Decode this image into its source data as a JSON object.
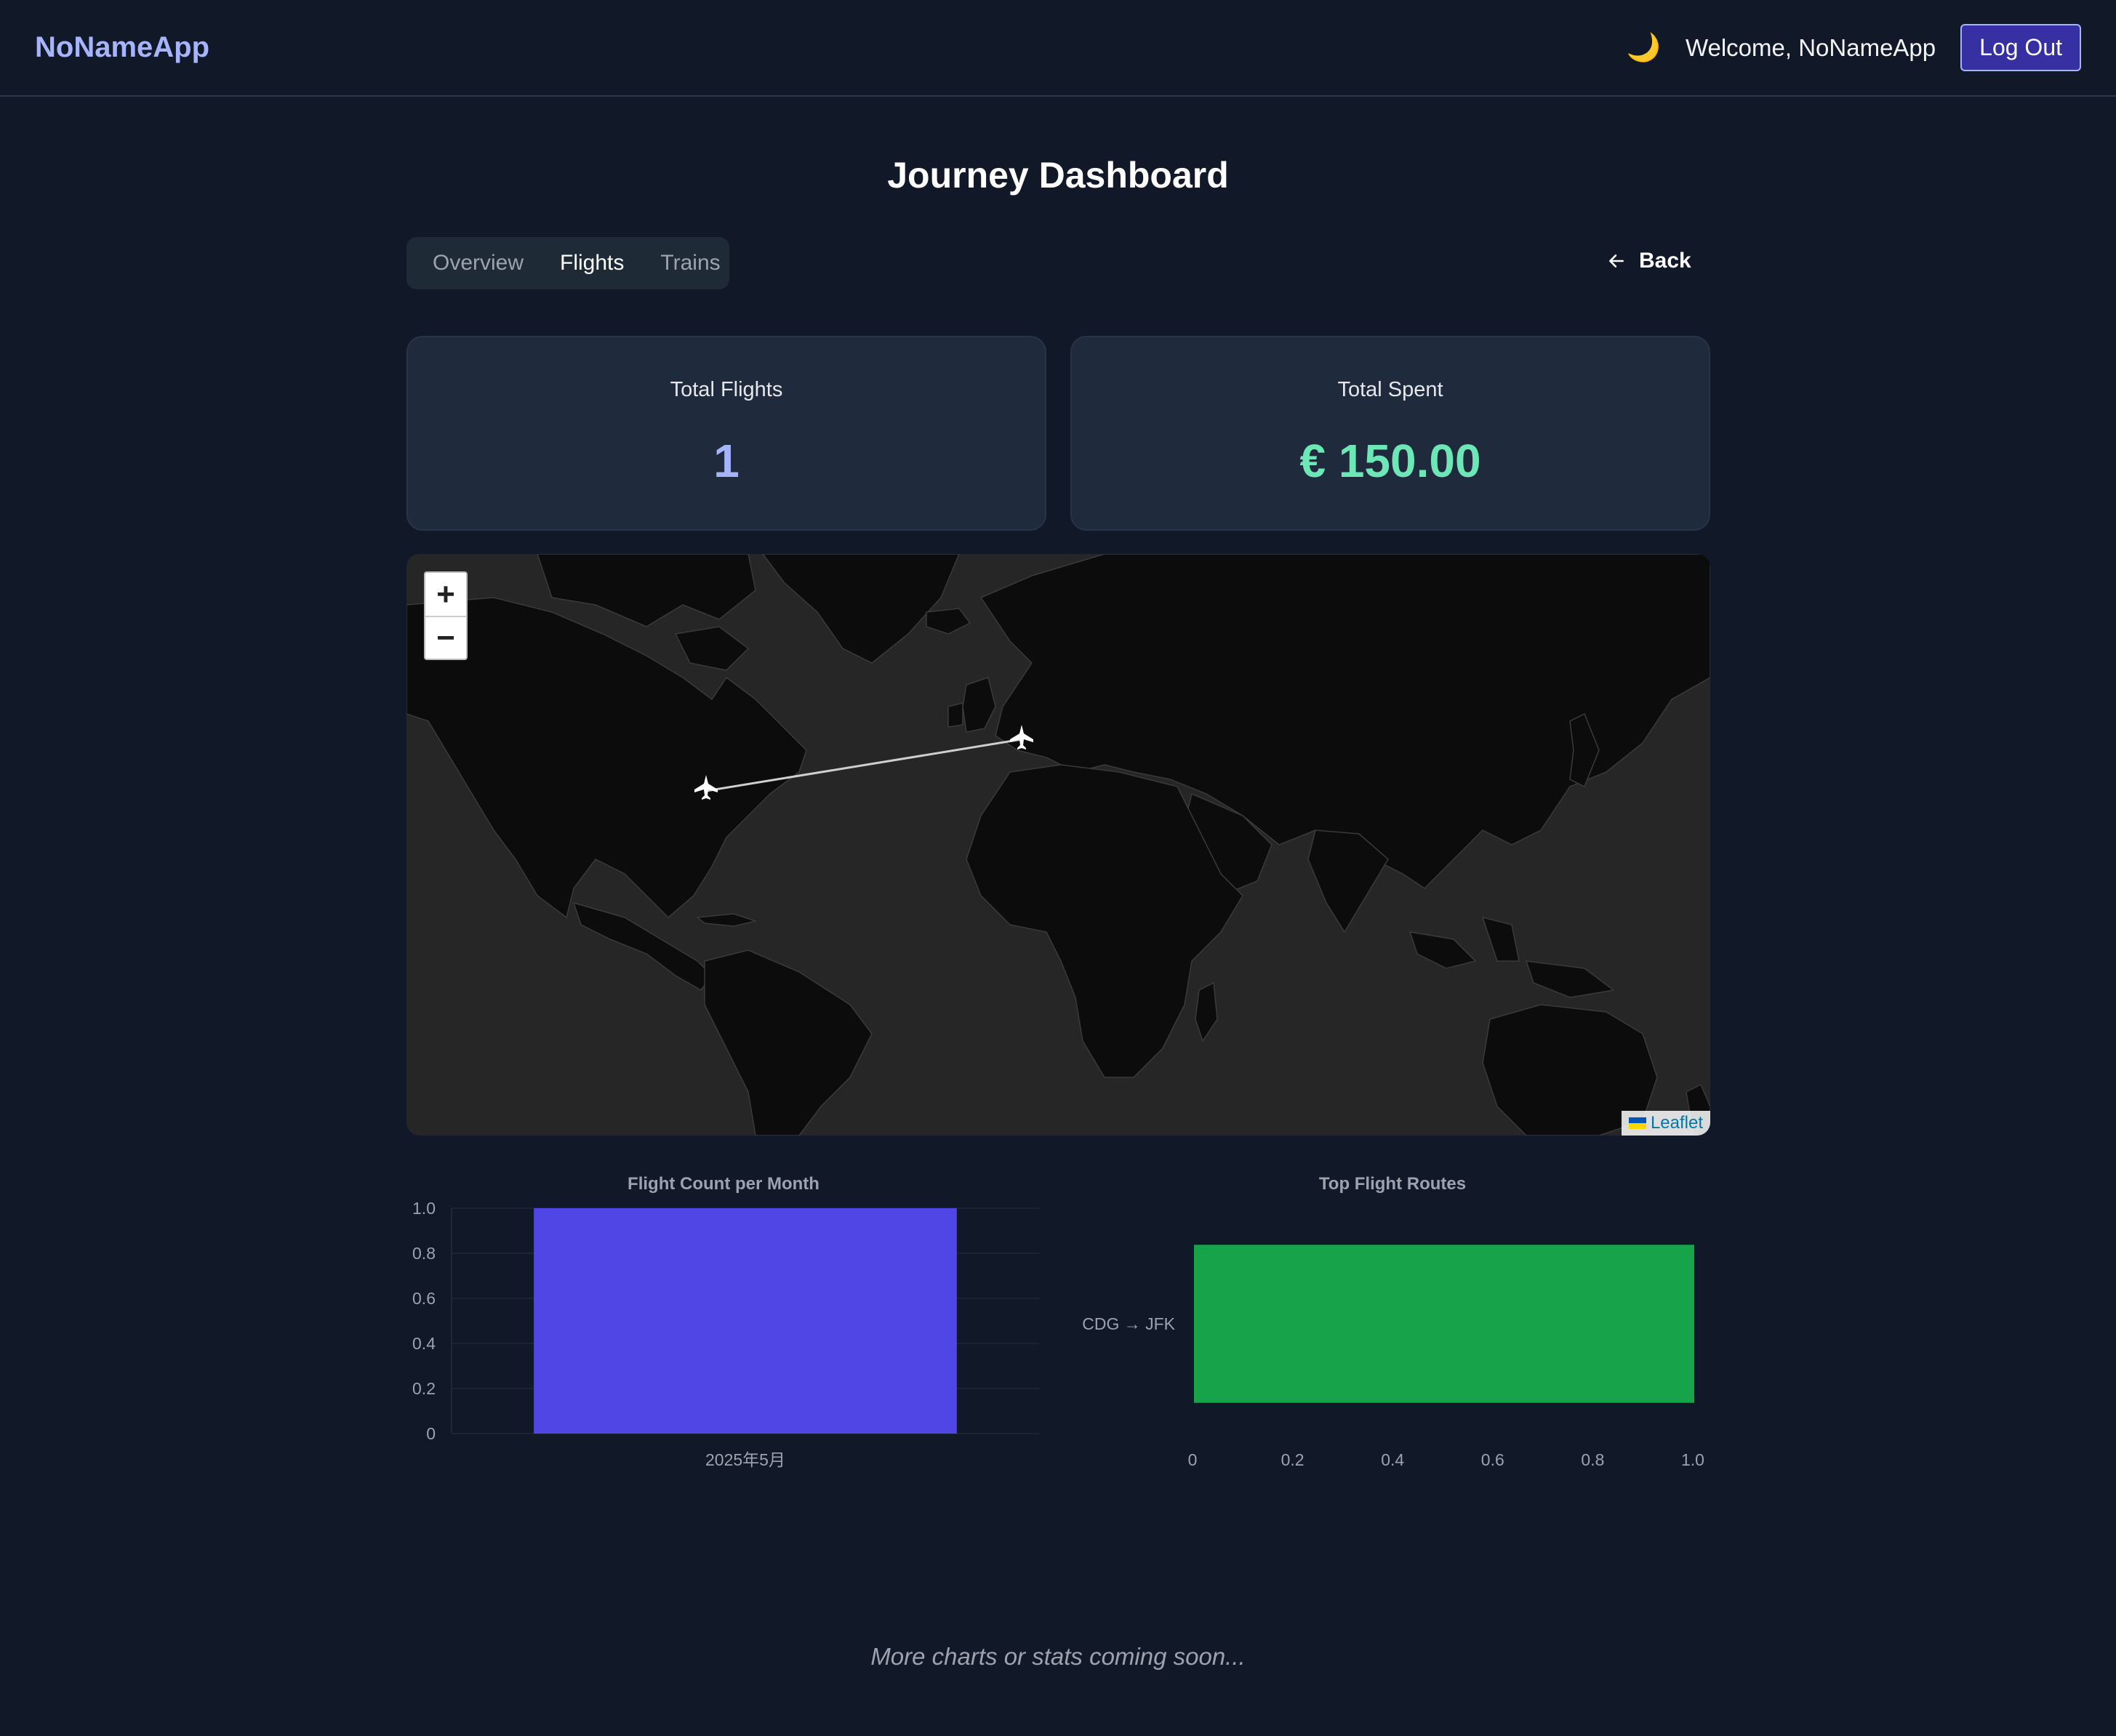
{
  "app": {
    "brand": "NoNameApp"
  },
  "header": {
    "theme_icon": "moon-icon",
    "theme_glyph": "🌙",
    "welcome": "Welcome, NoNameApp",
    "logout_label": "Log Out"
  },
  "page": {
    "title": "Journey Dashboard"
  },
  "tabs": [
    {
      "label": "Overview",
      "active": false
    },
    {
      "label": "Flights",
      "active": true
    },
    {
      "label": "Trains",
      "active": false
    }
  ],
  "back": {
    "icon": "arrow-left-icon",
    "label": "Back"
  },
  "stats": {
    "total_flights_label": "Total Flights",
    "total_flights_value": "1",
    "total_spent_label": "Total Spent",
    "total_spent_value": "€ 150.00"
  },
  "map": {
    "zoom_in": "+",
    "zoom_out": "−",
    "attribution": "Leaflet",
    "route": {
      "from": "JFK",
      "to": "CDG",
      "marker_icon": "airplane-icon"
    }
  },
  "chart_data": [
    {
      "type": "bar",
      "title": "Flight Count per Month",
      "categories": [
        "2025年5月"
      ],
      "values": [
        1
      ],
      "ylim": [
        0,
        1
      ],
      "yticks": [
        "0",
        "0.2",
        "0.4",
        "0.6",
        "0.8",
        "1.0"
      ],
      "color": "#4f46e5",
      "orientation": "vertical"
    },
    {
      "type": "bar",
      "title": "Top Flight Routes",
      "categories": [
        "CDG → JFK"
      ],
      "values": [
        1
      ],
      "xlim": [
        0,
        1
      ],
      "xticks": [
        "0",
        "0.2",
        "0.4",
        "0.6",
        "0.8",
        "1.0"
      ],
      "color": "#16a34a",
      "orientation": "horizontal"
    }
  ],
  "footer": {
    "text": "More charts or stats coming soon..."
  }
}
